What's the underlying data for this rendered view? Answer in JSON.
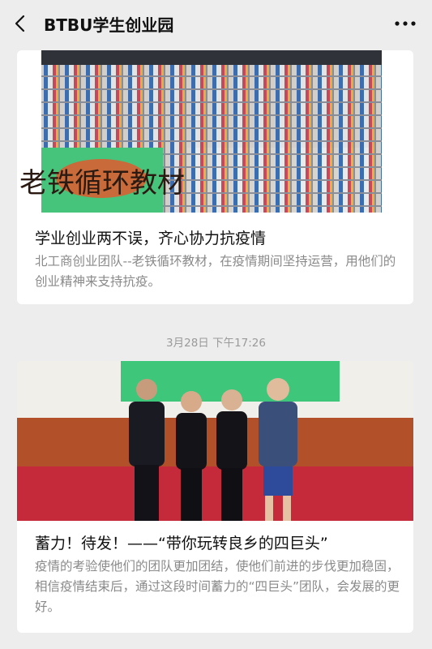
{
  "header": {
    "title": "BTBU学生创业园",
    "back_icon": "chevron-left-icon",
    "more_icon": "more-dots-icon"
  },
  "articles": [
    {
      "title": "学业创业两不误，齐心协力抗疫情",
      "description": "北工商创业团队--老铁循环教材，在疫情期间坚持运营，用他们的创业精神来支持抗疫。",
      "image_text": "老铁循环教材"
    },
    {
      "title": "蓄力！待发！——“带你玩转良乡的四巨头”",
      "description": "疫情的考验使他们的团队更加团结，使他们前进的步伐更加稳固，相信疫情结束后，通过这段时间蓄力的“四巨头”团队，会发展的更好。"
    }
  ],
  "timestamp": "3月28日 下午17:26",
  "colors": {
    "background": "#ededed",
    "card": "#ffffff",
    "green_screen": "#3ec77a",
    "carpet": "#c42a3a"
  }
}
